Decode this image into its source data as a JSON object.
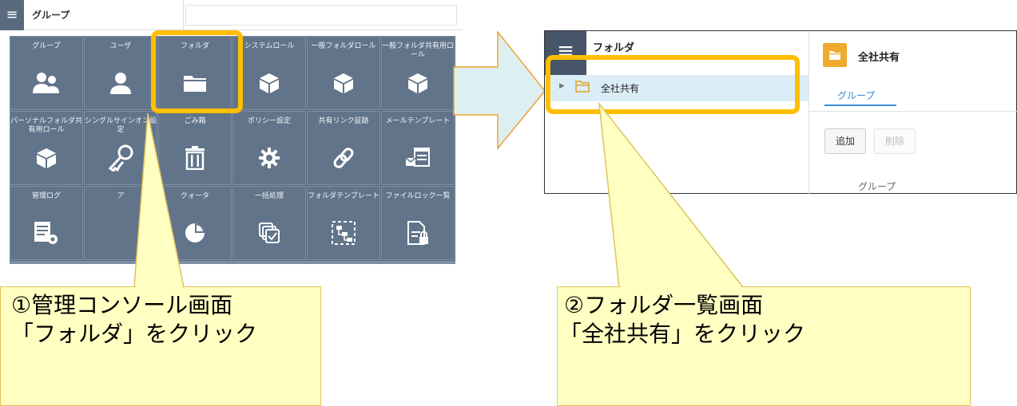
{
  "left_screen": {
    "menu_icon": "hamburger-icon",
    "title": "グループ",
    "tiles": [
      {
        "label": "グループ",
        "icon": "group-icon"
      },
      {
        "label": "ユーザ",
        "icon": "user-icon"
      },
      {
        "label": "フォルダ",
        "icon": "folder-icon"
      },
      {
        "label": "システムロール",
        "icon": "cube-icon"
      },
      {
        "label": "一般フォルダロール",
        "icon": "cube-icon"
      },
      {
        "label": "一般フォルダ共有用ロール",
        "icon": "cube-icon"
      },
      {
        "label": "パーソナルフォルダ共有用ロール",
        "icon": "cube-icon"
      },
      {
        "label": "シングルサインオン設定",
        "icon": "key-icon"
      },
      {
        "label": "ごみ箱",
        "icon": "trash-icon"
      },
      {
        "label": "ポリシー設定",
        "icon": "gear-icon"
      },
      {
        "label": "共有リンク証跡",
        "icon": "link-icon"
      },
      {
        "label": "メールテンプレート",
        "icon": "mail-template-icon"
      },
      {
        "label": "管理ログ",
        "icon": "log-settings-icon"
      },
      {
        "label": "ア",
        "icon": "app-icon"
      },
      {
        "label": "クォータ",
        "icon": "pie-chart-icon"
      },
      {
        "label": "一括処理",
        "icon": "batch-check-icon"
      },
      {
        "label": "フォルダテンプレート",
        "icon": "folder-template-icon"
      },
      {
        "label": "ファイルロック一覧",
        "icon": "file-lock-icon"
      }
    ]
  },
  "right_screen": {
    "menu_icon": "hamburger-icon",
    "title": "フォルダ",
    "tree_item": "全社共有",
    "detail_title": "全社共有",
    "tab": "グループ",
    "add_button": "追加",
    "delete_button": "削除",
    "column_header": "グループ"
  },
  "callouts": {
    "step1_line1": "①管理コンソール画面",
    "step1_line2": "「フォルダ」をクリック",
    "step2_line1": "②フォルダ一覧画面",
    "step2_line2": "「全社共有」をクリック"
  },
  "colors": {
    "highlight": "#ffbf00",
    "tile": "#61748a",
    "callout_fill": "#ffffc2",
    "arrow_fill": "#dcf0f2",
    "arrow_stroke": "#f0a030",
    "folder": "#f0ab2e",
    "tab_accent": "#3a8bd9"
  }
}
